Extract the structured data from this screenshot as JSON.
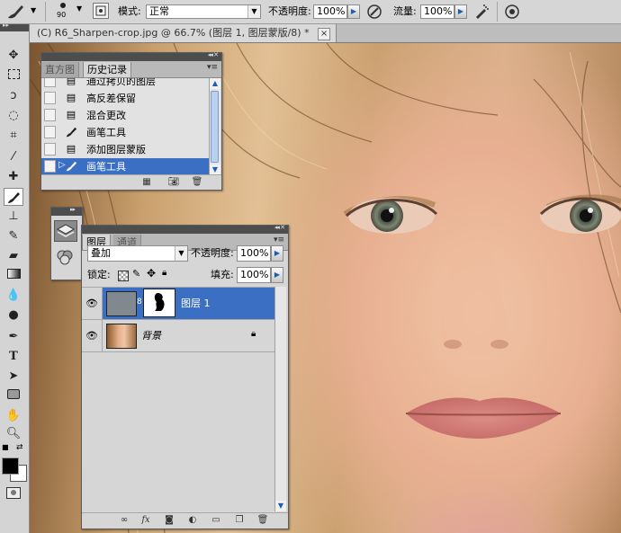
{
  "options_bar": {
    "brush_size": "90",
    "mode_label": "模式:",
    "mode_value": "正常",
    "opacity_label": "不透明度:",
    "opacity_value": "100%",
    "flow_label": "流量:",
    "flow_value": "100%"
  },
  "document": {
    "tab_title": "(C) R6_Sharpen-crop.jpg @ 66.7% (图层 1, 图层蒙版/8) *",
    "close": "×"
  },
  "history_panel": {
    "tabs": [
      "直方图",
      "历史记录"
    ],
    "active_tab": "历史记录",
    "items": [
      {
        "label": "通过拷贝的图层",
        "icon": "document-icon"
      },
      {
        "label": "高反差保留",
        "icon": "document-icon"
      },
      {
        "label": "混合更改",
        "icon": "document-icon"
      },
      {
        "label": "画笔工具",
        "icon": "brush-icon"
      },
      {
        "label": "添加图层蒙版",
        "icon": "document-icon"
      },
      {
        "label": "画笔工具",
        "icon": "brush-icon",
        "current": true
      }
    ]
  },
  "layers_panel": {
    "tabs": [
      "图层",
      "通道"
    ],
    "active_tab": "图层",
    "blend_mode": "叠加",
    "opacity_label": "不透明度:",
    "opacity_value": "100%",
    "lock_label": "锁定:",
    "fill_label": "填充:",
    "fill_value": "100%",
    "layers": [
      {
        "name": "图层 1",
        "selected": true,
        "has_mask": true
      },
      {
        "name": "背景",
        "locked": true
      }
    ]
  },
  "colors": {
    "selection_blue": "#3a6fc4",
    "panel_gray": "#d6d6d6",
    "app_dark": "#595959"
  }
}
